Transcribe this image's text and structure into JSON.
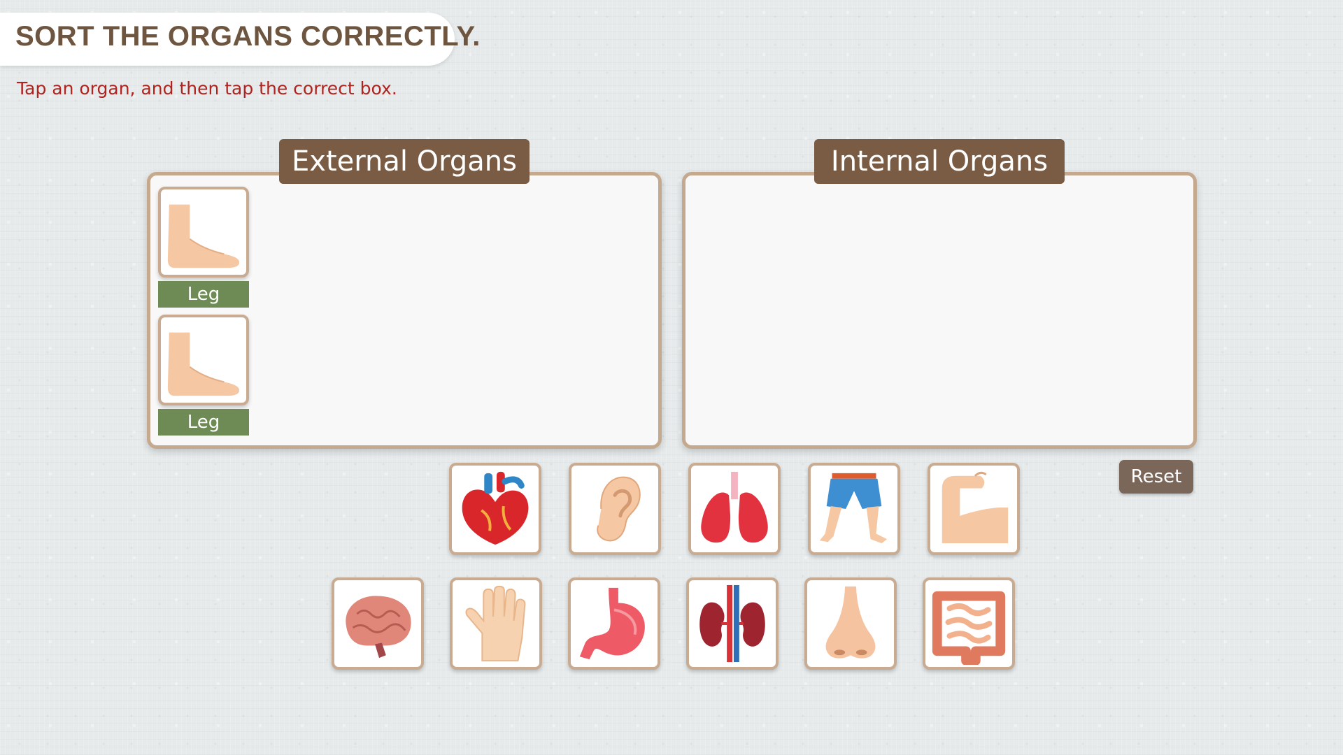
{
  "header": {
    "title": "SORT THE ORGANS CORRECTLY.",
    "instruction": "Tap an organ, and then tap the correct box."
  },
  "boxes": {
    "external": {
      "label": "External Organs",
      "placed": [
        {
          "label": "Leg",
          "icon": "foot-icon"
        },
        {
          "label": "Leg",
          "icon": "foot-icon"
        }
      ]
    },
    "internal": {
      "label": "Internal Organs",
      "placed": []
    }
  },
  "controls": {
    "reset_label": "Reset"
  },
  "tray": {
    "row1": [
      "heart-icon",
      "ear-icon",
      "lungs-icon",
      "legs-icon",
      "arm-icon"
    ],
    "row2": [
      "brain-icon",
      "hand-icon",
      "stomach-icon",
      "kidneys-icon",
      "nose-icon",
      "intestines-icon"
    ]
  },
  "colors": {
    "title_text": "#6d553f",
    "instruction_text": "#b0231f",
    "box_label_bg": "#7a5c45",
    "card_border": "#c9ab92",
    "placed_label_bg": "#6e8b55",
    "reset_bg": "#7b675a"
  }
}
